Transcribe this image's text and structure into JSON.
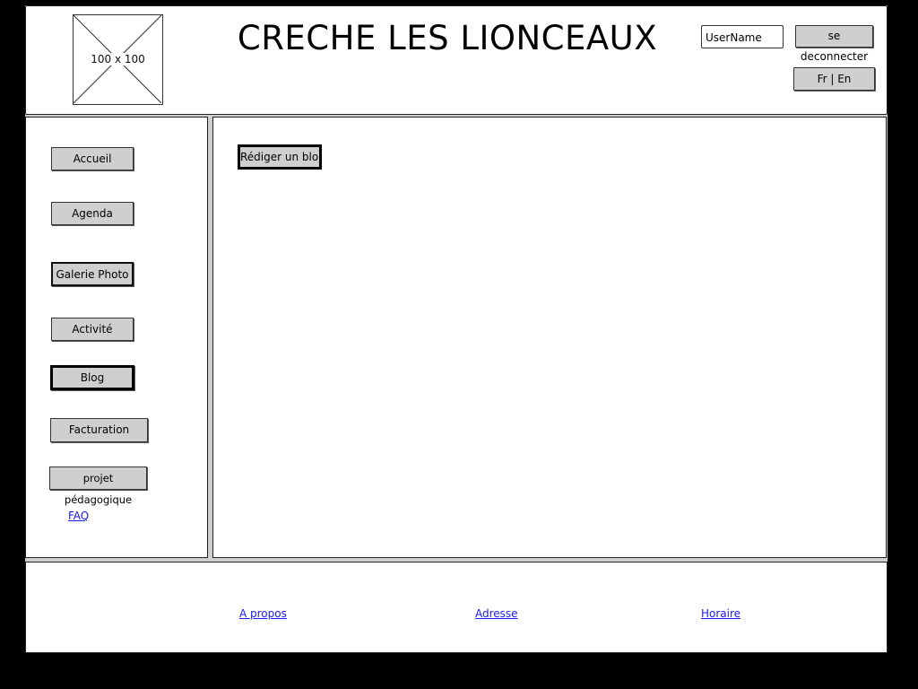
{
  "header": {
    "logo_placeholder_label": "100 x 100",
    "site_title": "CRECHE LES LIONCEAUX",
    "username_value": "UserName",
    "logout_label": "se deconnecter",
    "language_label": "Fr | En"
  },
  "sidebar": {
    "items": [
      {
        "label": "Accueil"
      },
      {
        "label": "Agenda"
      },
      {
        "label": "Galerie Photo"
      },
      {
        "label": "Activité"
      },
      {
        "label": "Blog"
      },
      {
        "label": "Facturation"
      },
      {
        "label": "projet pédagogique"
      }
    ],
    "faq_label": "FAQ"
  },
  "main": {
    "write_blog_label": "Rédiger un blog"
  },
  "footer": {
    "links": [
      {
        "label": "A propos"
      },
      {
        "label": "Adresse"
      },
      {
        "label": "Horaire"
      }
    ]
  }
}
